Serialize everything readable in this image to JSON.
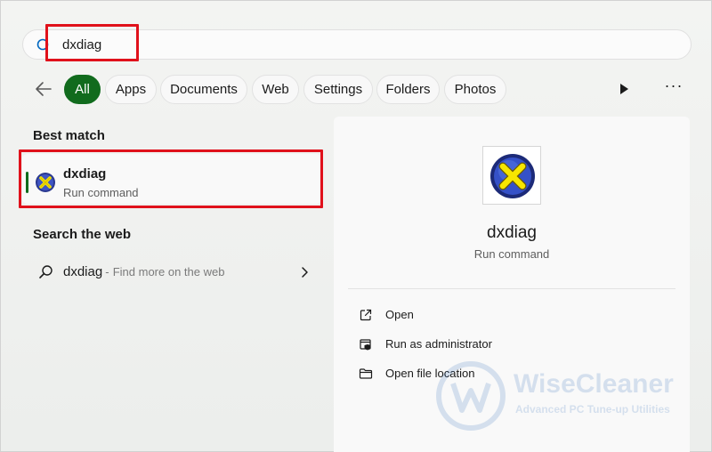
{
  "search": {
    "query": "dxdiag"
  },
  "filters": [
    "All",
    "Apps",
    "Documents",
    "Web",
    "Settings",
    "Folders",
    "Photos"
  ],
  "left": {
    "best_match_heading": "Best match",
    "best_match": {
      "title": "dxdiag",
      "subtitle": "Run command"
    },
    "web_heading": "Search the web",
    "web_result": {
      "query": "dxdiag",
      "separator": "-",
      "hint": "Find more on the web"
    }
  },
  "detail": {
    "title": "dxdiag",
    "subtitle": "Run command",
    "actions": [
      "Open",
      "Run as administrator",
      "Open file location"
    ]
  },
  "watermark": {
    "brand": "WiseCleaner",
    "tagline": "Advanced PC Tune-up Utilities"
  },
  "colors": {
    "accent": "#116b1d",
    "highlight": "#e0111b"
  }
}
